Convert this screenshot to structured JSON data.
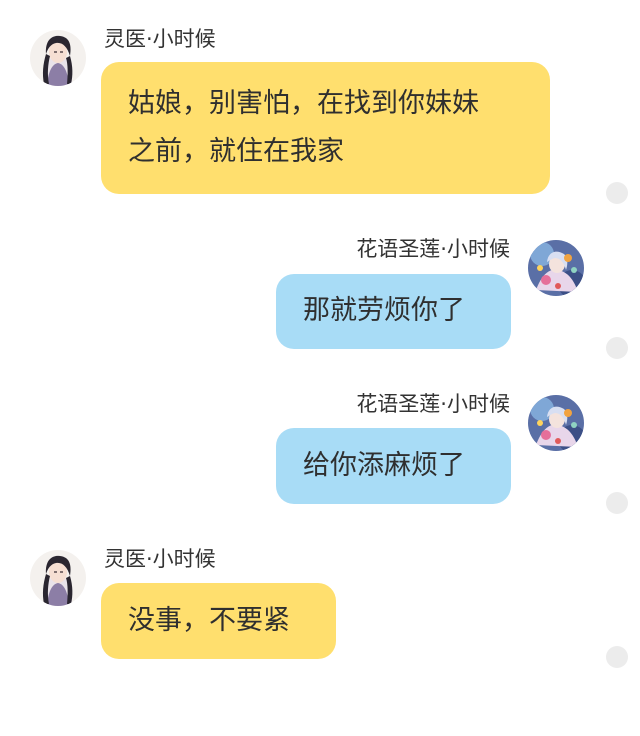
{
  "chat": {
    "messages": [
      {
        "side": "left",
        "sender": "灵医·小时候",
        "lines": [
          "姑娘，别害怕，在找到你妹妹",
          "之前，就住在我家"
        ],
        "avatar_icon": "male-ink-portrait-avatar"
      },
      {
        "side": "right",
        "sender": "花语圣莲·小时候",
        "lines": [
          "那就劳烦你了"
        ],
        "avatar_icon": "floral-fairy-avatar"
      },
      {
        "side": "right",
        "sender": "花语圣莲·小时候",
        "lines": [
          "给你添麻烦了"
        ],
        "avatar_icon": "floral-fairy-avatar"
      },
      {
        "side": "left",
        "sender": "灵医·小时候",
        "lines": [
          "没事，不要紧"
        ],
        "avatar_icon": "male-ink-portrait-avatar"
      }
    ]
  },
  "colors": {
    "left_bubble": "#ffdf6e",
    "right_bubble": "#a8dcf6",
    "read_dot": "#ececec"
  }
}
